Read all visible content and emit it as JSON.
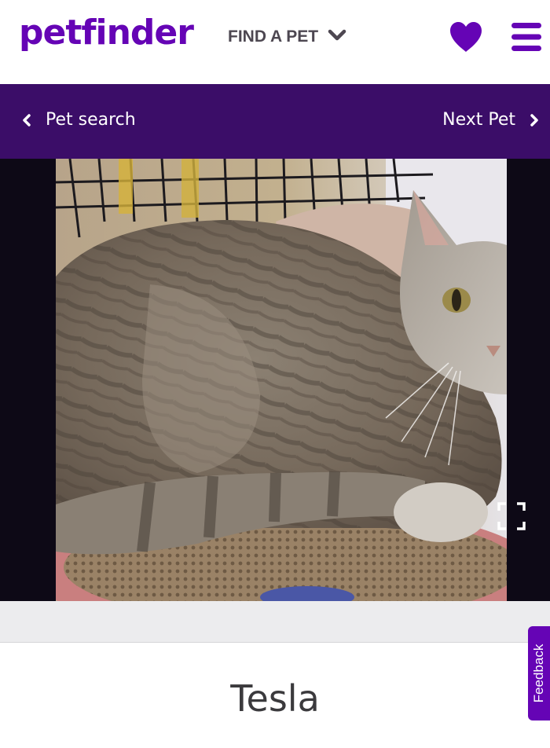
{
  "header": {
    "logo_text": "petfinder",
    "find_pet_label": "FIND A PET",
    "favorites_icon": "heart-icon",
    "menu_icon": "hamburger-menu-icon"
  },
  "nav": {
    "back_label": "Pet search",
    "next_label": "Next Pet"
  },
  "photo": {
    "alt": "Tesla",
    "expand_icon": "fullscreen-expand-icon"
  },
  "pet": {
    "name": "Tesla"
  },
  "feedback": {
    "label": "Feedback"
  },
  "colors": {
    "brand_purple": "#6504b5",
    "nav_purple": "#3b0d68",
    "photo_background": "#0d0916"
  }
}
